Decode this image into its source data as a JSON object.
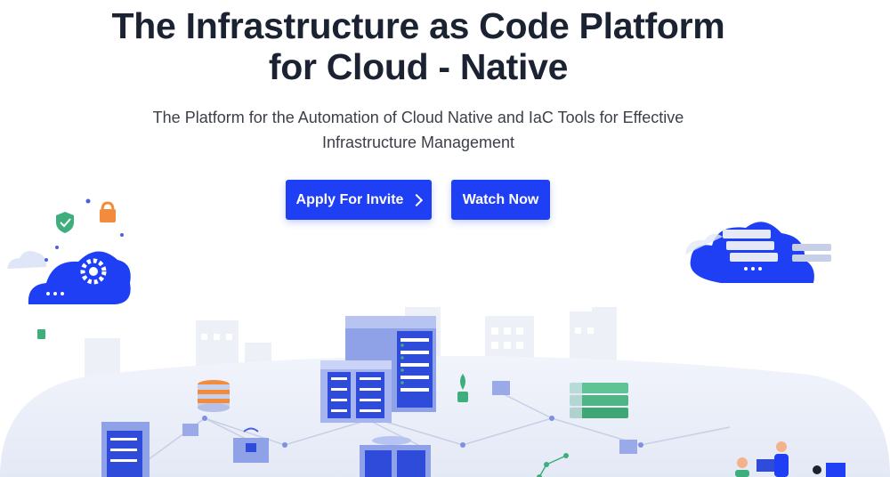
{
  "hero": {
    "title_line1": "The Infrastructure as Code Platform",
    "title_line2": "for Cloud - Native",
    "subtitle_line1": "The Platform for the Automation of Cloud Native and IaC Tools for Effective",
    "subtitle_line2": "Infrastructure Management"
  },
  "cta": {
    "apply_label": "Apply For Invite",
    "watch_label": "Watch Now"
  },
  "colors": {
    "primary": "#1f3ff5",
    "heading": "#1b2232",
    "body_text": "#3b3f47",
    "illustration_light": "#e9edf8"
  }
}
